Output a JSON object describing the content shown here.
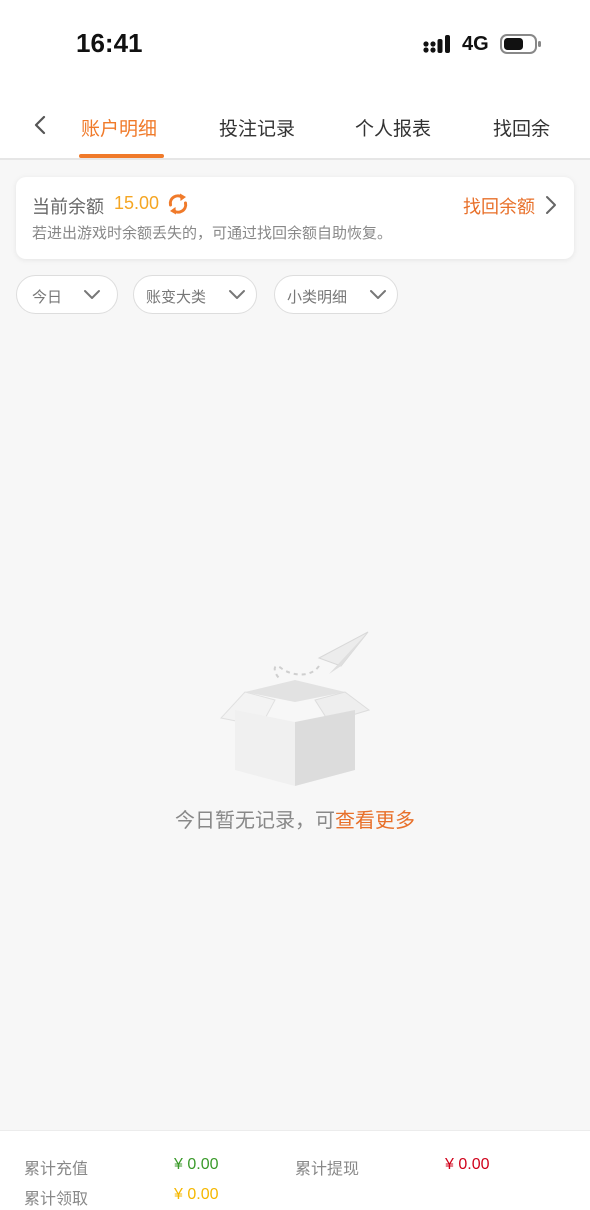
{
  "status_bar": {
    "time": "16:41",
    "network": "4G",
    "icons": [
      "signal-icon",
      "battery-icon"
    ]
  },
  "tabs": [
    {
      "label": "账户明细",
      "active": true
    },
    {
      "label": "投注记录",
      "active": false
    },
    {
      "label": "个人报表",
      "active": false
    },
    {
      "label": "找回余",
      "active": false
    }
  ],
  "balance": {
    "label": "当前余额",
    "value": "15.00",
    "recover_label": "找回余额",
    "note": "若进出游戏时余额丢失的，可通过找回余额自助恢复。"
  },
  "filters": [
    {
      "label": "今日"
    },
    {
      "label": "账变大类"
    },
    {
      "label": "小类明细"
    }
  ],
  "empty_state": {
    "text": "今日暂无记录，可",
    "link": "查看更多"
  },
  "footer": {
    "recharge_label": "累计充值",
    "recharge_value": "¥ 0.00",
    "withdraw_label": "累计提现",
    "withdraw_value": "¥ 0.00",
    "claim_label": "累计领取",
    "claim_value": "¥ 0.00"
  },
  "colors": {
    "accent": "#f07a2a",
    "balance": "#f5a623",
    "recharge": "#3a9a2a",
    "withdraw": "#d0021b",
    "claim": "#f5b700"
  }
}
